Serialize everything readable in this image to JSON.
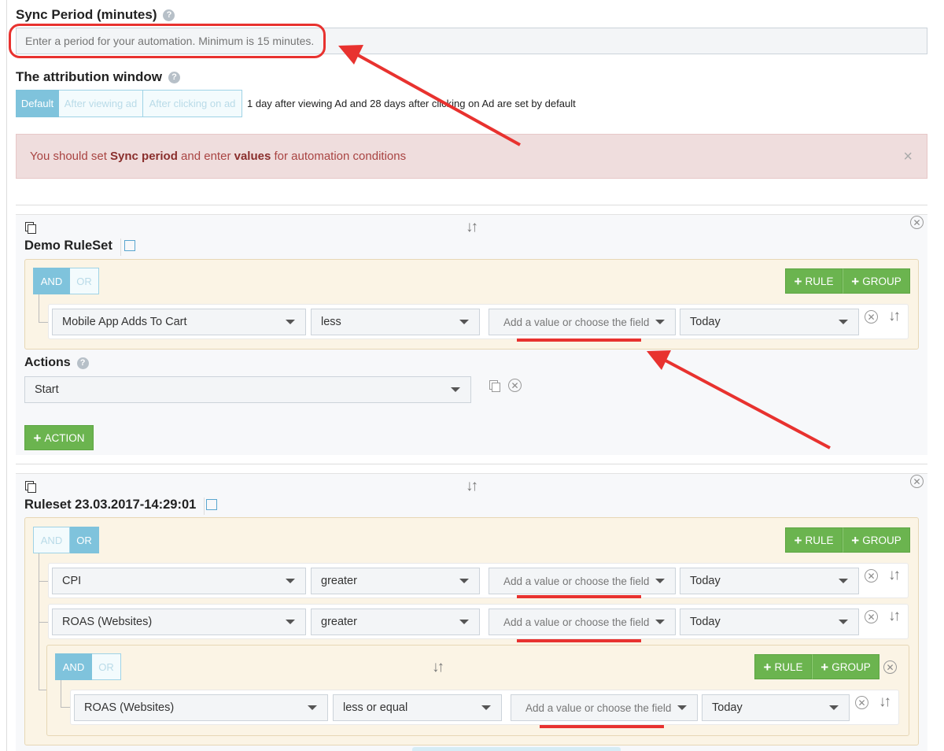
{
  "sync": {
    "label": "Sync Period (minutes)",
    "placeholder": "Enter a period for your automation. Minimum is 15 minutes."
  },
  "attribution": {
    "label": "The attribution window",
    "options": [
      "Default",
      "After viewing ad",
      "After clicking on ad"
    ],
    "note": "1 day after viewing Ad and 28 days after clicking on Ad are set by default"
  },
  "alert": {
    "prefix": "You should set ",
    "bold1": "Sync period",
    "mid": " and enter ",
    "bold2": "values",
    "suffix": " for automation conditions",
    "close": "×"
  },
  "common": {
    "and": "AND",
    "or": "OR",
    "rule_btn": "RULE",
    "group_btn": "GROUP",
    "value_placeholder": "Add a value or choose the field",
    "action_btn": "ACTION"
  },
  "ruleset1": {
    "name": "Demo RuleSet",
    "rule": {
      "metric": "Mobile App Adds To Cart",
      "operator": "less",
      "period": "Today"
    },
    "actions_label": "Actions",
    "action": "Start"
  },
  "ruleset2": {
    "name": "Ruleset 23.03.2017-14:29:01",
    "rules": [
      {
        "metric": "CPI",
        "operator": "greater",
        "period": "Today"
      },
      {
        "metric": "ROAS (Websites)",
        "operator": "greater",
        "period": "Today"
      }
    ],
    "subgroup_rule": {
      "metric": "ROAS (Websites)",
      "operator": "less or equal",
      "period": "Today"
    }
  },
  "colors": {
    "annotation": "#e8322f",
    "green": "#6bb44f",
    "blue": "#7fc3dc"
  }
}
